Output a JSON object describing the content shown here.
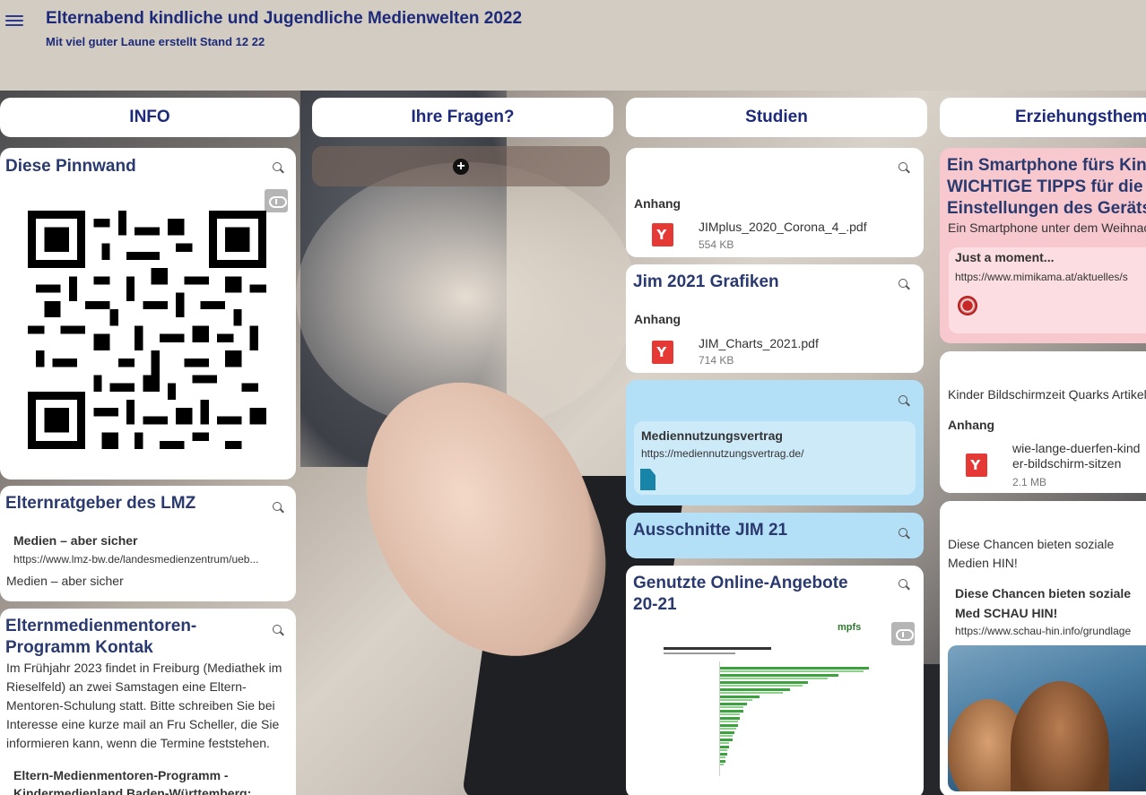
{
  "header": {
    "title": "Elternabend kindliche und Jugendliche Medienwelten 2022",
    "subtitle": "Mit viel guter Laune erstellt Stand 12 22"
  },
  "columns": [
    "INFO",
    "Ihre Fragen?",
    "Studien",
    "Erziehungsthem"
  ],
  "info": {
    "pinnwand_title": "Diese Pinnwand",
    "lmz_title": "Elternratgeber des LMZ",
    "lmz_link_title": "Medien – aber sicher",
    "lmz_link_url": "https://www.lmz-bw.de/landesmedienzentrum/ueb...",
    "lmz_caption": "Medien – aber sicher",
    "mentor_title": "Elternmedienmentoren-Programm Kontak",
    "mentor_body": "Im Frühjahr 2023 findet in Freiburg (Mediathek im Rieselfeld) an zwei Samstagen eine Eltern-Mentoren-Schulung statt. Bitte schreiben Sie bei Interesse eine kurze mail an Fru Scheller, die Sie informieren kann, wenn die Termine feststehen.",
    "mentor_link_title": "Eltern-Medienmentoren-Programm - Kindermedienland Baden-Württemberg:"
  },
  "studien": {
    "card1_attach_label": "Anhang",
    "card1_file": "JIMplus_2020_Corona_4_.pdf",
    "card1_size": "554 KB",
    "card2_title": "Jim 2021 Grafiken",
    "card2_attach_label": "Anhang",
    "card2_file": "JIM_Charts_2021.pdf",
    "card2_size": "714 KB",
    "card3_link_title": "Mediennutzungsvertrag",
    "card3_link_url": "https://mediennutzungsvertrag.de/",
    "card4_title": "Ausschnitte JIM 21",
    "card5_title": "Genutzte Online-Angebote 20-21",
    "card5_logo": "mpfs"
  },
  "erziehung": {
    "card1_title": "Ein Smartphone fürs Kind WICHTIGE TIPPS für die Einstellungen des Geräts",
    "card1_text": "Ein Smartphone unter dem Weihnac",
    "card1_link_title": "Just a moment...",
    "card1_link_url": "https://www.mimikama.at/aktuelles/s",
    "card2_text": "Kinder Bildschirmzeit Quarks Artikel",
    "card2_attach_label": "Anhang",
    "card2_file": "wie-lange-duerfen-kinder-bildschirm-sitzen",
    "card2_size": "2.1 MB",
    "card3_text": "Diese Chancen bieten soziale Medien HIN!",
    "card3_link_title": "Diese Chancen bieten soziale Med SCHAU HIN!",
    "card3_link_url": "https://www.schau-hin.info/grundlage"
  },
  "colors": {
    "title_blue": "#1d2a7a",
    "card_pink": "#f8c8cf",
    "card_lightblue": "#b3dff7",
    "pdf_red": "#e53935"
  }
}
